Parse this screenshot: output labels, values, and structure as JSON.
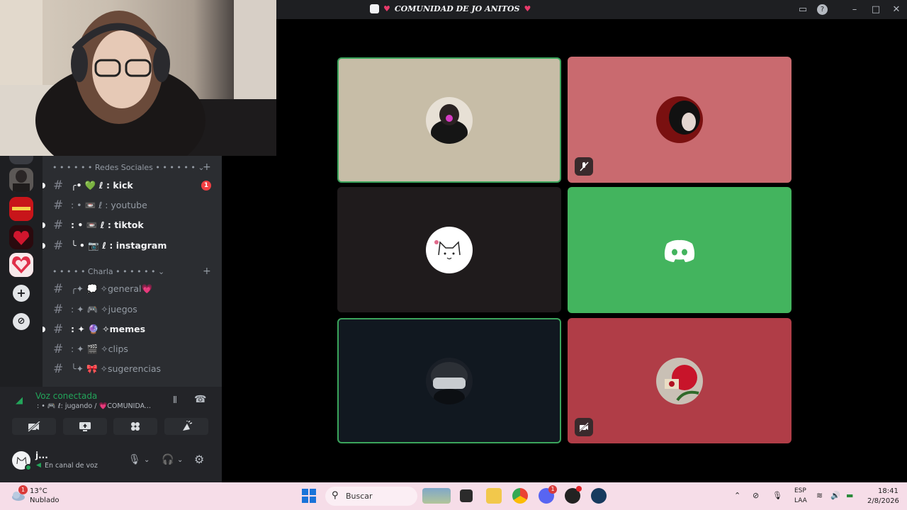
{
  "window": {
    "title": "COMUNIDAD DE JO ANITOS",
    "colors": {
      "bg": "#000000",
      "titlebar": "#1e1f22",
      "accent_green": "#3ba55c"
    }
  },
  "stage": {
    "tiles": [
      {
        "id": "tile-1",
        "bg": "#c7bda7",
        "active": true,
        "muted": false,
        "avatar": "dark-photo-avatar"
      },
      {
        "id": "tile-2",
        "bg": "#c96a6f",
        "active": false,
        "muted": true,
        "avatar": "red-photo-avatar"
      },
      {
        "id": "tile-3",
        "bg": "#1f1b1c",
        "active": false,
        "muted": false,
        "avatar": "cat-doodle-avatar"
      },
      {
        "id": "tile-4",
        "bg": "#43b45e",
        "active": false,
        "muted": false,
        "avatar": "discord-logo"
      },
      {
        "id": "tile-5",
        "bg": "#111820",
        "active": true,
        "muted": false,
        "avatar": "helmet-avatar"
      },
      {
        "id": "tile-6",
        "bg": "#b03d47",
        "active": false,
        "muted": true,
        "avatar": "roses-avatar"
      }
    ]
  },
  "sidebar": {
    "categories": [
      {
        "label": "• • • • • • Redes Sociales • • • • • •"
      },
      {
        "label": "• • • • • Charla • • • • • •"
      }
    ],
    "channels": [
      {
        "label": "╭• 💚 ℓ : kick",
        "unread": true,
        "badge": "1"
      },
      {
        "label": ": • 📼 ℓ : youtube",
        "unread": false
      },
      {
        "label": ": • 📼 ℓ : tiktok",
        "unread": true
      },
      {
        "label": "╰ • 📷 ℓ : instagram",
        "unread": true
      },
      {
        "label": "╭✦ 💭 ✧general💗",
        "unread": false
      },
      {
        "label": ": ✦ 🎮 ✧juegos",
        "unread": false
      },
      {
        "label": ": ✦ 🔮 ✧memes",
        "unread": true
      },
      {
        "label": ": ✦ 🎬 ✧clips",
        "unread": false
      },
      {
        "label": "╰✦ 🎀 ✧sugerencias",
        "unread": false
      }
    ]
  },
  "voice": {
    "status": "Voz conectada",
    "channel": ": • 🎮 ℓ: jugando / 💗COMUNIDA...",
    "buttons": [
      "video-off-icon",
      "screen-share-icon",
      "activities-icon",
      "soundboard-icon"
    ]
  },
  "user": {
    "name": "j...",
    "status": "En canal de voz"
  },
  "taskbar": {
    "weather_temp": "13°C",
    "weather_cond": "Nublado",
    "weather_badge": "1",
    "search_label": "Buscar",
    "lang_1": "ESP",
    "lang_2": "LAA",
    "time": "18:41",
    "date": "2/8/2026",
    "discord_badge": "1"
  }
}
